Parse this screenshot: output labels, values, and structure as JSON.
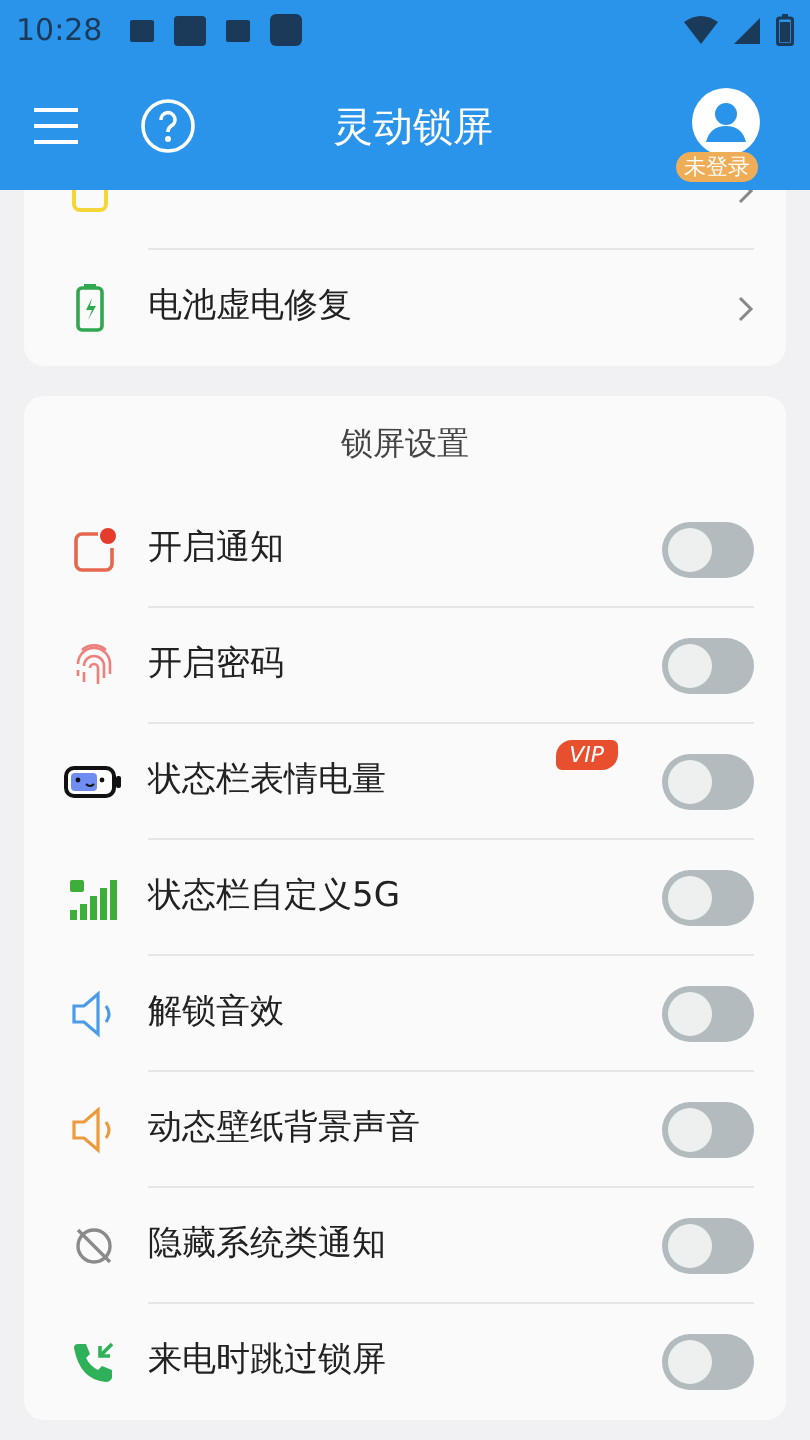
{
  "status_bar": {
    "time": "10:28"
  },
  "header": {
    "title": "灵动锁屏",
    "login_badge": "未登录"
  },
  "top_card": {
    "rows": [
      {
        "kind": "theme"
      },
      {
        "kind": "battery",
        "label": "电池虚电修复"
      }
    ]
  },
  "lock_settings": {
    "title": "锁屏设置",
    "rows": [
      {
        "kind": "notify",
        "label": "开启通知",
        "on": false
      },
      {
        "kind": "fingerprint",
        "label": "开启密码",
        "on": false
      },
      {
        "kind": "face-battery",
        "label": "状态栏表情电量",
        "badge": "VIP",
        "on": false
      },
      {
        "kind": "signal",
        "label": "状态栏自定义5G",
        "on": false
      },
      {
        "kind": "speaker-blue",
        "label": "解锁音效",
        "on": false
      },
      {
        "kind": "speaker-orange",
        "label": "动态壁纸背景声音",
        "on": false
      },
      {
        "kind": "hide",
        "label": "隐藏系统类通知",
        "on": false
      },
      {
        "kind": "phone",
        "label": "来电时跳过锁屏",
        "on": false
      }
    ]
  }
}
